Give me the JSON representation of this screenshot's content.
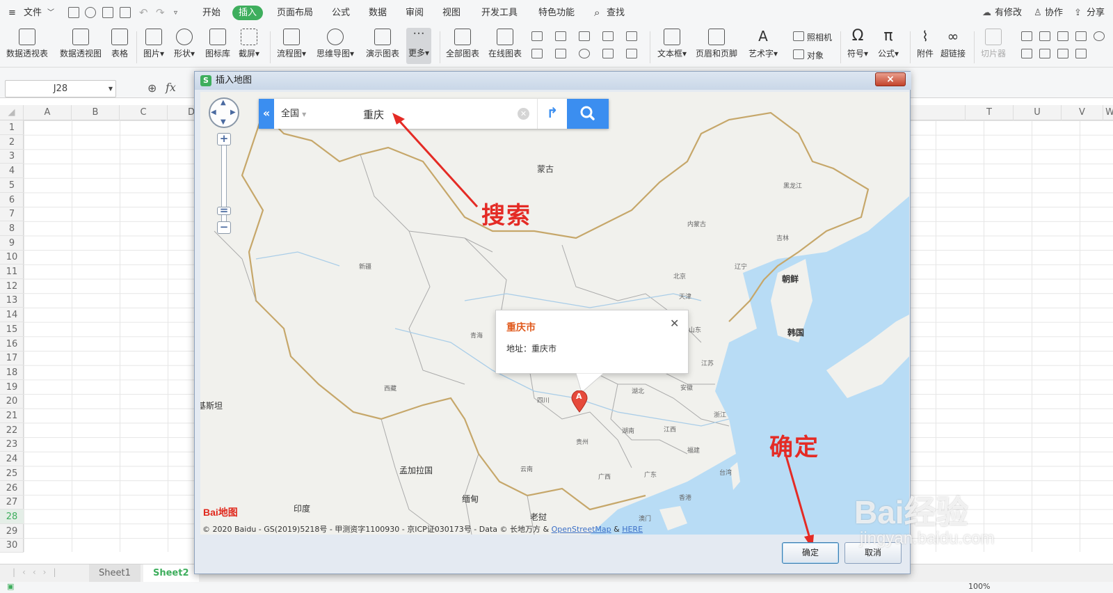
{
  "menubar": {
    "file": "文件",
    "tabs": [
      "开始",
      "插入",
      "页面布局",
      "公式",
      "数据",
      "审阅",
      "视图",
      "开发工具",
      "特色功能"
    ],
    "search": "查找",
    "right": [
      "有修改",
      "协作",
      "分享"
    ]
  },
  "ribbon": {
    "items": [
      "数据透视表",
      "数据透视图",
      "表格",
      "图片",
      "形状",
      "图标库",
      "截屏",
      "流程图",
      "思维导图",
      "演示图表",
      "更多",
      "全部图表",
      "在线图表",
      "文本框",
      "页眉和页脚",
      "艺术字",
      "符号",
      "公式",
      "附件",
      "超链接",
      "切片器"
    ],
    "camera": "照相机",
    "object": "对象"
  },
  "formula": {
    "cell": "J28",
    "fx": "fx"
  },
  "columns_left": [
    "A",
    "B",
    "C",
    "D"
  ],
  "columns_right": [
    "T",
    "U",
    "V",
    "W"
  ],
  "rows": [
    "1",
    "2",
    "3",
    "4",
    "5",
    "6",
    "7",
    "8",
    "9",
    "10",
    "11",
    "12",
    "13",
    "14",
    "15",
    "16",
    "17",
    "18",
    "19",
    "20",
    "21",
    "22",
    "23",
    "24",
    "25",
    "26",
    "27",
    "28",
    "29",
    "30"
  ],
  "sheets": [
    "Sheet1",
    "Sheet2"
  ],
  "status": {
    "zoom": "100%"
  },
  "dialog": {
    "title": "插入地图",
    "close": "×",
    "ok": "确定",
    "cancel": "取消"
  },
  "map": {
    "region": "全国",
    "query": "重庆",
    "popup_title": "重庆市",
    "popup_address": "地址：重庆市",
    "marker": "A",
    "labels": {
      "mongolia": "蒙古",
      "heilongjiang": "黑龙江",
      "neimenggu": "内蒙古",
      "jilin": "吉林",
      "liaoning": "辽宁",
      "xinjiang": "新疆",
      "qinghai": "青海",
      "xizang": "西藏",
      "korea_n": "朝鲜",
      "korea_s": "韩国",
      "beijing": "北京",
      "tianjin": "天津",
      "shandong": "山东",
      "jiangsu": "江苏",
      "sichuan": "四川",
      "hubei": "湖北",
      "anhui": "安徽",
      "zhejiang": "浙江",
      "jiangxi": "江西",
      "hunan": "湖南",
      "guizhou": "贵州",
      "fujian": "福建",
      "taiwan": "台湾",
      "yunnan": "云南",
      "guangxi": "广西",
      "guangdong": "广东",
      "hongkong": "香港",
      "macau": "澳门",
      "bangladesh": "孟加拉国",
      "india": "印度",
      "myanmar": "缅甸",
      "laos": "老挝",
      "pakistan": "基斯坦"
    },
    "annotation_search": "搜索",
    "annotation_ok": "确定",
    "copyright": "© 2020 Baidu - GS(2019)5218号 - 甲测资字1100930 - 京ICP证030173号 - Data © 长地万方 &",
    "osm": "OpenStreetMap",
    "and": "&",
    "here": "HERE",
    "logo": "Bai地图"
  },
  "watermark": {
    "main": "Bai经验",
    "url": "jingyan.baidu.com"
  },
  "colors": {
    "accent": "#3eae5d",
    "map_blue": "#3b8ef0",
    "annotation": "#e42b25",
    "sea": "#b8dcf5"
  }
}
